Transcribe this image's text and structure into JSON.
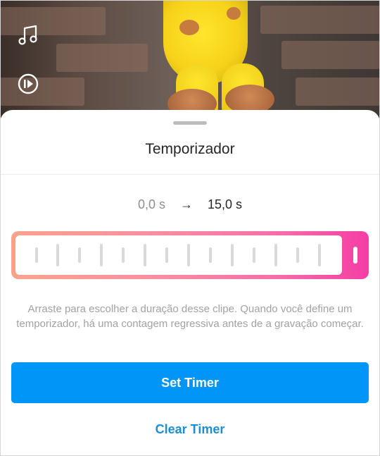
{
  "preview": {
    "icons": [
      "music-note-icon",
      "play-circle-icon"
    ]
  },
  "sheet": {
    "title": "Temporizador",
    "range": {
      "start": "0,0 s",
      "arrow": "→",
      "end": "15,0 s"
    },
    "slider": {
      "selected_fraction": 1.0
    },
    "description": "Arraste para escolher a duração desse clipe. Quando você define um temporizador, há uma contagem regressiva antes de a gravação começar.",
    "set_timer_label": "Set Timer",
    "clear_timer_label": "Clear Timer"
  },
  "colors": {
    "primary": "#0095f6",
    "link": "#1a8fd4",
    "slider_gradient_start": "#f9a38a",
    "slider_gradient_end": "#f53da5"
  }
}
